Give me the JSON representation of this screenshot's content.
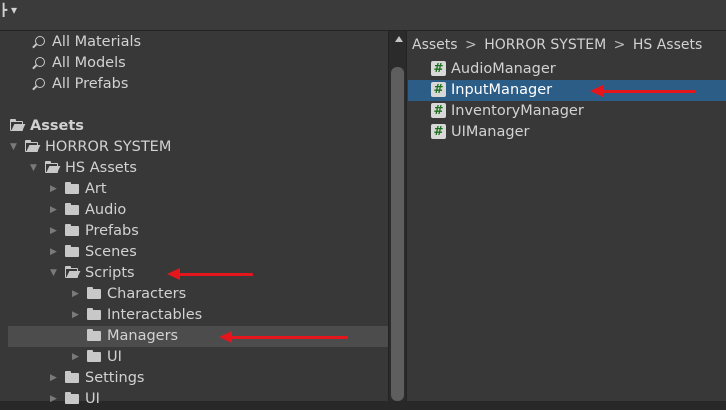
{
  "toolbar": {
    "plus_icon": "plus-dropdown-icon"
  },
  "favorites": [
    {
      "label": "All Materials"
    },
    {
      "label": "All Models"
    },
    {
      "label": "All Prefabs"
    }
  ],
  "tree": [
    {
      "label": "Assets",
      "depth": 0,
      "bold": true,
      "open": true,
      "arrow": false
    },
    {
      "label": "HORROR SYSTEM",
      "depth": 1,
      "open": true,
      "expander": "down"
    },
    {
      "label": "HS Assets",
      "depth": 2,
      "open": true,
      "expander": "down"
    },
    {
      "label": "Art",
      "depth": 3,
      "expander": "right"
    },
    {
      "label": "Audio",
      "depth": 3,
      "expander": "right"
    },
    {
      "label": "Prefabs",
      "depth": 3,
      "expander": "right"
    },
    {
      "label": "Scenes",
      "depth": 3,
      "expander": "right"
    },
    {
      "label": "Scripts",
      "depth": 3,
      "open": true,
      "expander": "down"
    },
    {
      "label": "Characters",
      "depth": 4,
      "expander": "right"
    },
    {
      "label": "Interactables",
      "depth": 4,
      "expander": "right"
    },
    {
      "label": "Managers",
      "depth": 4,
      "selected": true
    },
    {
      "label": "UI",
      "depth": 4,
      "expander": "right"
    },
    {
      "label": "Settings",
      "depth": 3,
      "expander": "right"
    },
    {
      "label": "UI",
      "depth": 3,
      "expander": "right"
    }
  ],
  "breadcrumb": {
    "items": [
      "Assets",
      "HORROR SYSTEM",
      "HS Assets"
    ],
    "separator": ">"
  },
  "files": [
    {
      "label": "AudioManager"
    },
    {
      "label": "InputManager",
      "selected": true
    },
    {
      "label": "InventoryManager"
    },
    {
      "label": "UIManager"
    }
  ],
  "colors": {
    "selection_blue": "#2c5d87",
    "annotation_red": "#e4161c",
    "tree_selected": "#4c4c4c"
  }
}
